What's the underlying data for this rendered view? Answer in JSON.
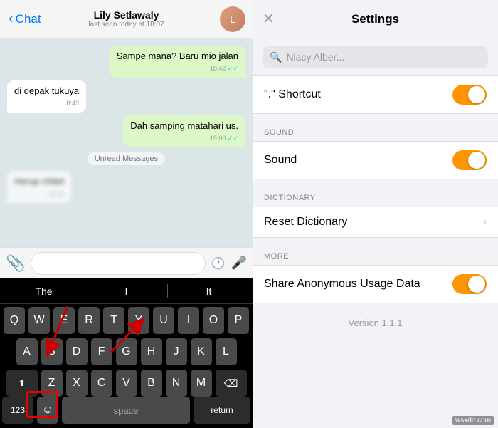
{
  "left": {
    "header": {
      "back_label": "Chat",
      "contact_name": "Lily Setlawaly",
      "contact_status": "last seen today at 18:07",
      "avatar_initial": "L"
    },
    "messages": [
      {
        "type": "out",
        "text": "Sampe mana? Baru mio jalan",
        "time": "18:42",
        "ticks": true
      },
      {
        "type": "in",
        "text": "di depak tukuya",
        "time": "8:43"
      },
      {
        "type": "out",
        "text": "Dah samping matahari us.",
        "time": "19:00",
        "ticks": true
      },
      {
        "type": "divider",
        "text": "Unread Messages"
      },
      {
        "type": "in-blurred",
        "text": "Herup chitet",
        "time": "19:01"
      }
    ],
    "input_placeholder": "",
    "keyboard": {
      "suggestions": [
        "The",
        "I",
        "It"
      ],
      "row1": [
        "Q",
        "W",
        "E",
        "R",
        "T",
        "Y",
        "U",
        "I",
        "O",
        "P"
      ],
      "row2": [
        "A",
        "S",
        "D",
        "F",
        "G",
        "H",
        "J",
        "K",
        "L"
      ],
      "row3": [
        "Z",
        "X",
        "C",
        "V",
        "B",
        "N",
        "M"
      ],
      "space_label": "space",
      "return_label": "return"
    }
  },
  "right": {
    "header": {
      "title": "Settings",
      "close_icon": "✕"
    },
    "search_placeholder": "Nlacy Alber...",
    "sections": [
      {
        "items": [
          {
            "label": "\".\" Shortcut",
            "type": "toggle",
            "on": true
          }
        ]
      },
      {
        "header": "SOUND",
        "items": [
          {
            "label": "Sound",
            "type": "toggle",
            "on": true
          }
        ]
      },
      {
        "header": "DICTIONARY",
        "items": [
          {
            "label": "Reset Dictionary",
            "type": "chevron"
          }
        ]
      },
      {
        "header": "MORE",
        "items": [
          {
            "label": "Share Anonymous Usage Data",
            "type": "toggle",
            "on": true
          }
        ]
      }
    ],
    "version": "Version 1.1.1",
    "watermark": "wsxdn.com"
  }
}
